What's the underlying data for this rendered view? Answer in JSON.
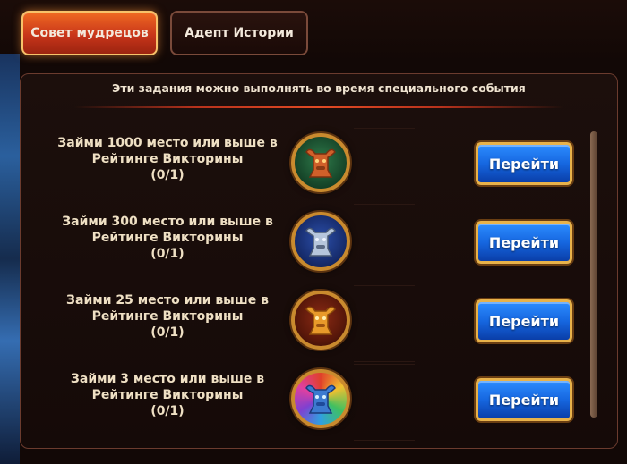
{
  "tabs": [
    {
      "label": "Совет мудрецов",
      "active": true
    },
    {
      "label": "Адепт Истории",
      "active": false
    }
  ],
  "header": "Эти задания можно выполнять во время специального события",
  "tasks": [
    {
      "line1": "Займи 1000 место или выше в",
      "line2": "Рейтинге Викторины",
      "progress": "(0/1)",
      "medal_icon": "bronze-bull-medal-icon",
      "button": "Перейти"
    },
    {
      "line1": "Займи 300 место или выше в",
      "line2": "Рейтинге Викторины",
      "progress": "(0/1)",
      "medal_icon": "silver-bull-medal-icon",
      "button": "Перейти"
    },
    {
      "line1": "Займи 25 место или выше в",
      "line2": "Рейтинге Викторины",
      "progress": "(0/1)",
      "medal_icon": "gold-bull-medal-icon",
      "button": "Перейти"
    },
    {
      "line1": "Займи 3 место или выше в",
      "line2": "Рейтинге Викторины",
      "progress": "(0/1)",
      "medal_icon": "rainbow-bull-medal-icon",
      "button": "Перейти"
    }
  ],
  "colors": {
    "active_tab": "#e0521e",
    "button_blue": "#1667e0",
    "button_border": "#e8b24a",
    "medal_bronze": "#c8642a",
    "medal_silver": "#9fb6d6",
    "medal_gold": "#e0962a",
    "medal_rainbow": "#4a8ad8"
  }
}
